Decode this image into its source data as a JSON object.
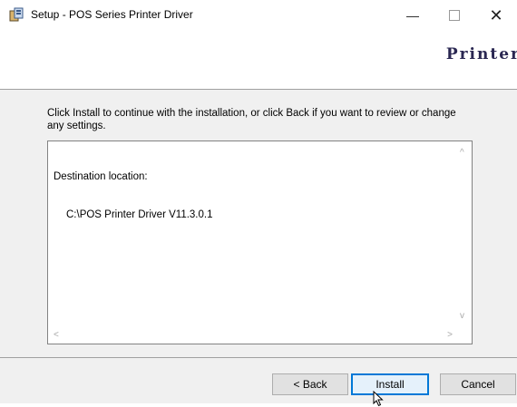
{
  "window": {
    "title": "Setup - POS Series Printer Driver",
    "minimize_glyph": "—",
    "close_glyph": "✕"
  },
  "header": {
    "brand": "Printer"
  },
  "main": {
    "instruction": "Click Install to continue with the installation, or click Back if you want to review or change any settings.",
    "memo": {
      "line1": "Destination location:",
      "line2": "C:\\POS Printer Driver V11.3.0.1"
    },
    "scroll_icons": {
      "up": "^",
      "down": "v",
      "left": "<",
      "right": ">"
    }
  },
  "footer": {
    "back_label": "< Back",
    "install_label": "Install",
    "cancel_label": "Cancel"
  },
  "colors": {
    "accent": "#0078d7",
    "brand": "#2a2752",
    "panel": "#f0f0f0"
  }
}
